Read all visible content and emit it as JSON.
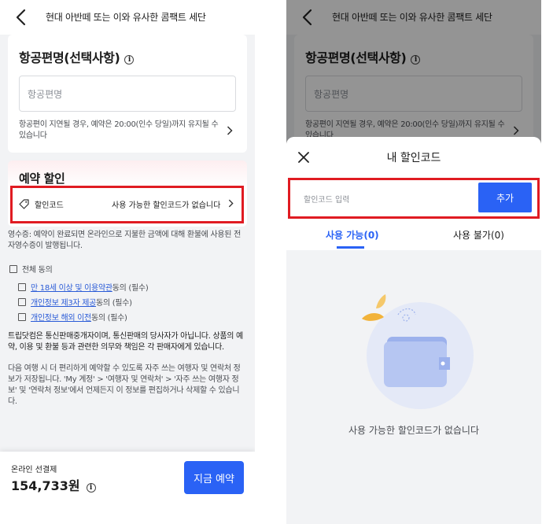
{
  "header": {
    "title": "현대 아반떼 또는 이와 유사한 콤팩트 세단"
  },
  "flight": {
    "title": "항공편명(선택사항)",
    "info_glyph": "i",
    "placeholder": "항공편명",
    "note": "항공편이 지연될 경우, 예약은 20:00(인수 당일)까지 유지될 수 있습니다"
  },
  "discount": {
    "title": "예약 할인",
    "code_label": "할인코드",
    "code_status": "사용 가능한 할인코드가 없습니다"
  },
  "receipt_note": "영수증: 예약이 완료되면 온라인으로 지불한 금액에 대해 환불에 사용된 전자영수증이 발행됩니다.",
  "agreements": {
    "all_label": "전체 동의",
    "items": [
      {
        "link": "만 18세 이상 및 이용약관",
        "suffix": "동의 (필수)"
      },
      {
        "link": "개인정보 제3자 제공",
        "suffix": "동의 (필수)"
      },
      {
        "link": "개인정보 해외 이전",
        "suffix": "동의 (필수)"
      }
    ]
  },
  "disclaimer": "트립닷컴은 통신판매중개자이며, 통신판매의 당사자가 아닙니다. 상품의 예약, 이용 및 환불 등과 관련한 의무와 책임은 각 판매자에게 있습니다.",
  "traveler_note": "다음 여행 시 더 편리하게 예약할 수 있도록 자주 쓰는 여행자 및 연락처 정보가 저장됩니다. 'My 계정' > '여행자 및 연락처' > '자주 쓰는 여행자 정보' 및 '연락처 정보'에서 언제든지 이 정보를 편집하거나 삭제할 수 있습니다.",
  "footer": {
    "payment_label": "온라인 선결제",
    "price": "154,733원",
    "book_button": "지금 예약"
  },
  "discount_sheet": {
    "title": "내 할인코드",
    "input_placeholder": "할인코드 입력",
    "add_button": "추가",
    "tabs": [
      {
        "label": "사용 가능(0)",
        "active": true
      },
      {
        "label": "사용 불가(0)",
        "active": false
      }
    ],
    "empty_text": "사용 가능한 할인코드가 없습니다"
  },
  "colors": {
    "accent": "#2a62f5",
    "highlight_box": "#e01b22",
    "link": "#2a5bd7",
    "section_tint": "#fdeef0"
  },
  "icons": [
    "back-arrow-icon",
    "info-icon",
    "tag-icon",
    "chevron-right-icon",
    "close-icon",
    "wallet-illustration"
  ]
}
